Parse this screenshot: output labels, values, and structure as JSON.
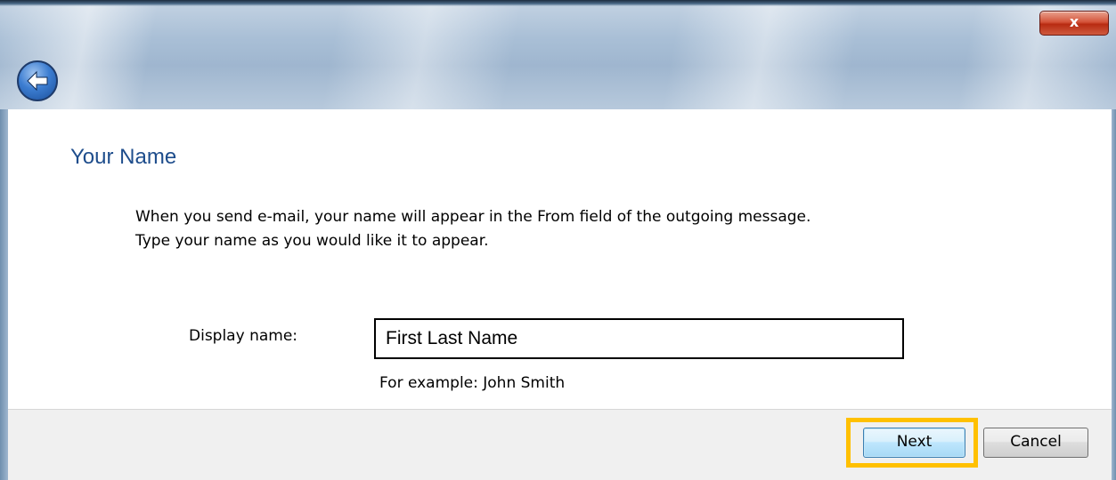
{
  "titlebar": {
    "close_label": "x",
    "back_icon": "back-arrow-icon"
  },
  "page": {
    "title": "Your Name",
    "description_line1": "When you send e-mail, your name will appear in the From field of the outgoing message.",
    "description_line2": "Type your name as you would like it to appear."
  },
  "form": {
    "display_name_label": "Display name:",
    "display_name_value": "First Last Name",
    "example_text": "For example: John Smith"
  },
  "footer": {
    "next_label": "Next",
    "cancel_label": "Cancel",
    "highlight_color": "#ffc000"
  },
  "colors": {
    "title_color": "#1e4d8c",
    "close_button": "#c43c1e"
  }
}
